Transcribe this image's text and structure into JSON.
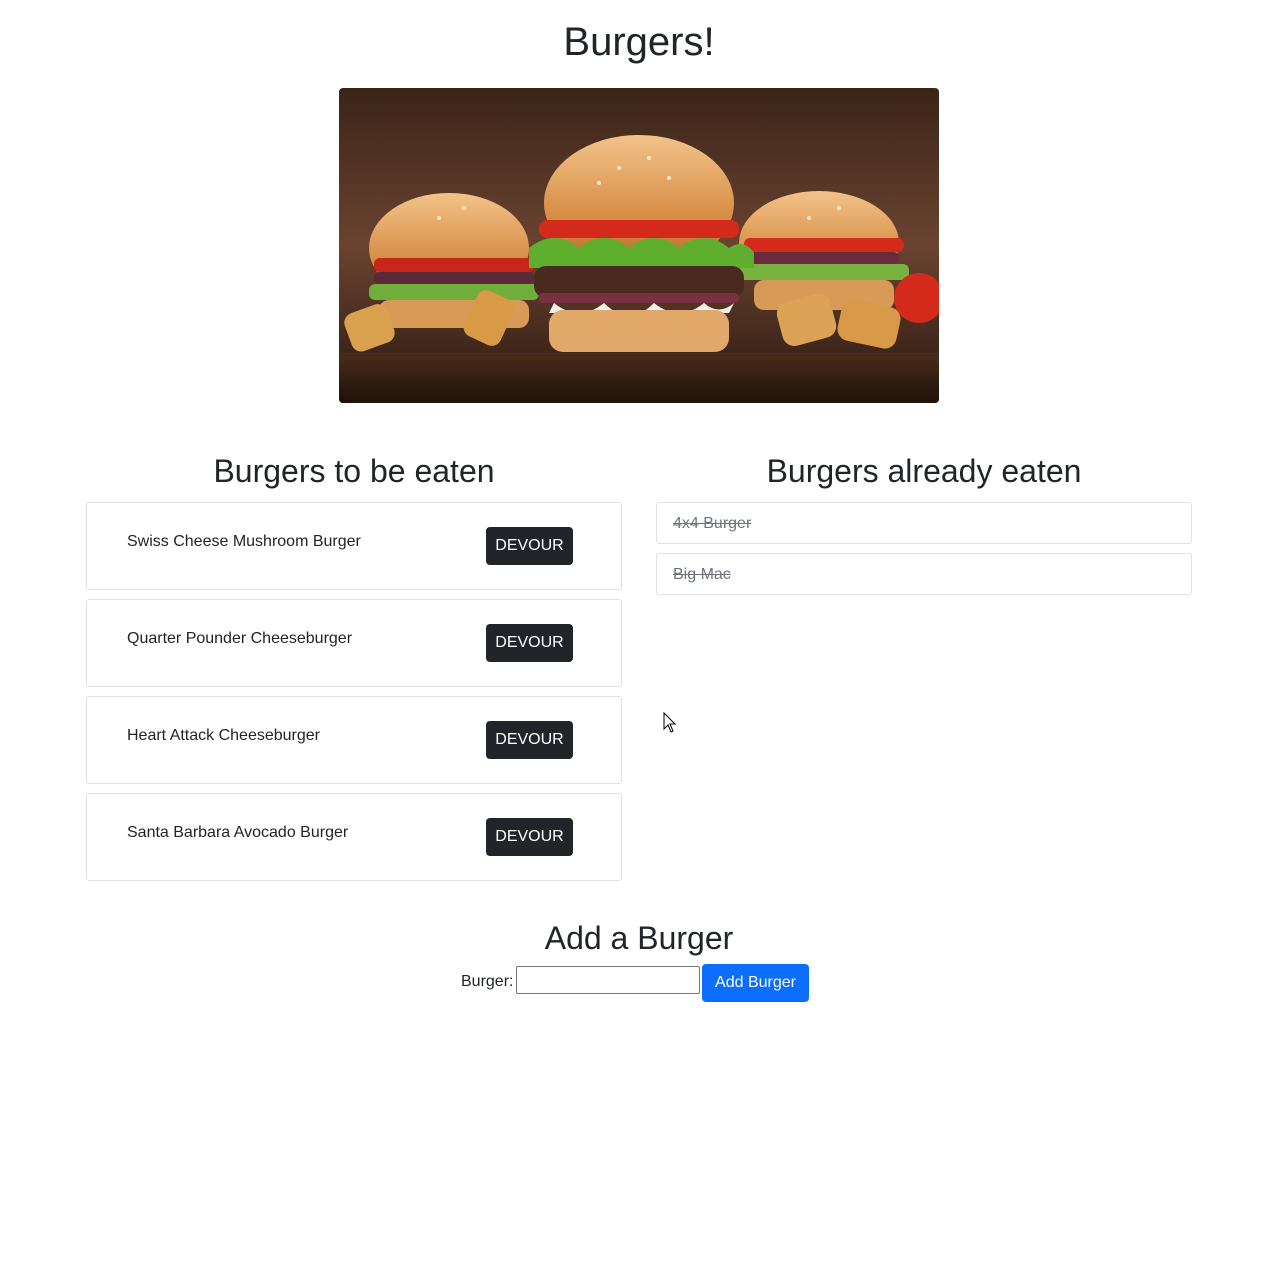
{
  "page": {
    "title": "Burgers!"
  },
  "hero": {
    "image": "burgers-on-wooden-board"
  },
  "to_eat": {
    "heading": "Burgers to be eaten",
    "button_label": "DEVOUR",
    "items": [
      {
        "name": "Swiss Cheese Mushroom Burger"
      },
      {
        "name": "Quarter Pounder Cheeseburger"
      },
      {
        "name": "Heart Attack Cheeseburger"
      },
      {
        "name": "Santa Barbara Avocado Burger"
      }
    ]
  },
  "eaten": {
    "heading": "Burgers already eaten",
    "items": [
      {
        "name": "4x4 Burger"
      },
      {
        "name": "Big Mac"
      }
    ]
  },
  "add_form": {
    "heading": "Add a Burger",
    "label": "Burger:",
    "input_value": "",
    "button_label": "Add Burger"
  },
  "colors": {
    "devour_button": "#212529",
    "add_button": "#0d6efd",
    "eaten_text": "#6c757d"
  }
}
